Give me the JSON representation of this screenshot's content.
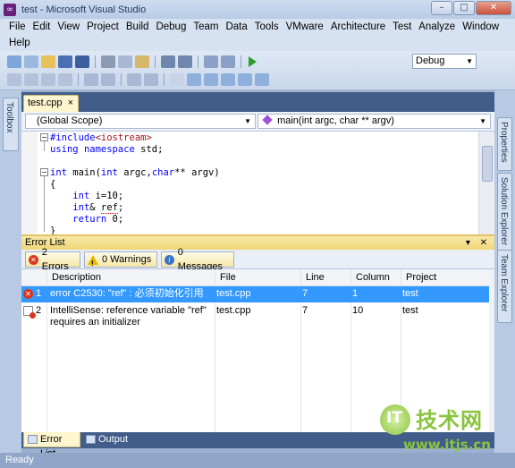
{
  "window": {
    "title": "test - Microsoft Visual Studio",
    "minimize": "–",
    "maximize": "□",
    "close": "✕"
  },
  "menu": {
    "row1": [
      "File",
      "Edit",
      "View",
      "Project",
      "Build",
      "Debug",
      "Team",
      "Data",
      "Tools",
      "VMware",
      "Architecture",
      "Test",
      "Analyze",
      "Window"
    ],
    "row2": [
      "Help"
    ]
  },
  "toolbar": {
    "configuration": "Debug"
  },
  "sidebars": {
    "left": "Toolbox",
    "right": [
      "Properties",
      "Solution Explorer",
      "Team Explorer"
    ]
  },
  "editor": {
    "tab": "test.cpp",
    "tab_close": "×",
    "scope": "(Global Scope)",
    "member": "main(int argc, char ** argv)",
    "code": [
      "#include<iostream>",
      "using namespace std;",
      "",
      "int main(int argc,char** argv)",
      "{",
      "    int i=10;",
      "    int& ref;",
      "    return 0;",
      "}"
    ]
  },
  "error_list": {
    "title": "Error List",
    "header_controls": "▾ ✕",
    "filters": {
      "errors": "2 Errors",
      "warnings": "0 Warnings",
      "messages": "0 Messages"
    },
    "columns": [
      "Description",
      "File",
      "Line",
      "Column",
      "Project"
    ],
    "rows": [
      {
        "index": "1",
        "description": "error C2530: \"ref\" : 必须初始化引用",
        "file": "test.cpp",
        "line": "7",
        "column": "1",
        "project": "test"
      },
      {
        "index": "2",
        "description": "IntelliSense: reference variable \"ref\" requires an initializer",
        "file": "test.cpp",
        "line": "7",
        "column": "10",
        "project": "test"
      }
    ]
  },
  "bottom_tabs": [
    "Error List",
    "Output"
  ],
  "status": "Ready",
  "watermark": {
    "logo": "IT",
    "brand": "技术网",
    "url": "www.itjs.cn"
  }
}
